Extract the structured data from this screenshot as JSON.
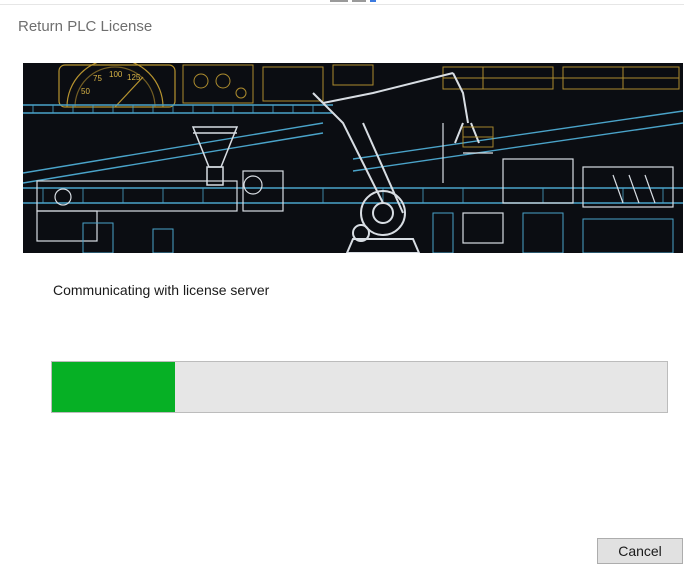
{
  "window": {
    "title": "Return PLC License"
  },
  "banner": {
    "gauge_labels": [
      "75",
      "100",
      "125",
      "50"
    ]
  },
  "status": {
    "message": "Communicating with license server"
  },
  "progress": {
    "fraction": 0.2,
    "fill_color": "#06b025",
    "track_color": "#e6e6e6"
  },
  "buttons": {
    "cancel_label": "Cancel"
  }
}
